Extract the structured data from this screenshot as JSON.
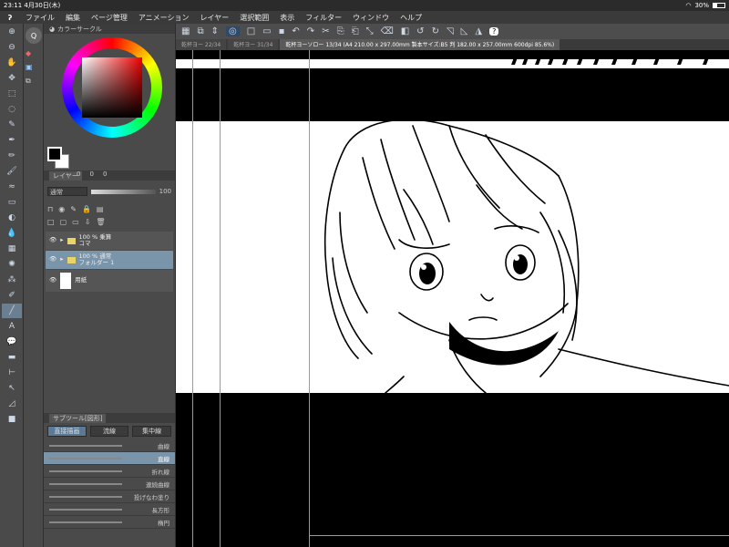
{
  "status": {
    "time": "23:11",
    "date": "4月30日(木)",
    "battery": "30%"
  },
  "menu": [
    "ファイル",
    "編集",
    "ページ管理",
    "アニメーション",
    "レイヤー",
    "選択範囲",
    "表示",
    "フィルター",
    "ウィンドウ",
    "ヘルプ"
  ],
  "color_panel": {
    "title": "カラーサークル",
    "rgb": [
      "0",
      "0",
      "0"
    ],
    "fg": "#000000",
    "bg": "#ffffff"
  },
  "layer_panel": {
    "tab": "レイヤー",
    "blend": "通常",
    "opacity": "100",
    "layers": [
      {
        "line1": "100 % 乗算",
        "line2": "コマ"
      },
      {
        "line1": "100 % 通常",
        "line2": "フォルダー 1"
      },
      {
        "line1": "",
        "line2": "用紙"
      }
    ]
  },
  "subtool_panel": {
    "title": "サブツール[図形]",
    "tabs": [
      "直接描画",
      "流線",
      "集中線"
    ],
    "items": [
      "曲線",
      "直線",
      "折れ線",
      "連続曲線",
      "投げなわ塗り",
      "長方形",
      "楕円"
    ]
  },
  "doc_tabs": [
    "乾杯ヨー 22/34",
    "乾杯ヨー 31/34",
    "乾杯ヨーソロー 13/34 (A4 210.00 x 297.00mm 製本サイズ:B5 判 182.00 x 257.00mm 600dpi 85.6%)"
  ],
  "accent": "#7a95aa"
}
